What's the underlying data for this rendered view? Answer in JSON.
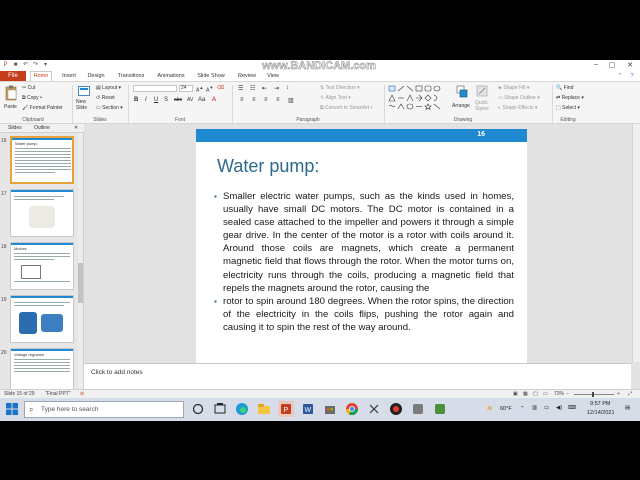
{
  "titlebar": {
    "watermark": "www.BANDICAM.com",
    "minimize": "–",
    "maximize": "▢",
    "close": "✕"
  },
  "tabs": [
    "File",
    "Home",
    "Insert",
    "Design",
    "Transitions",
    "Animations",
    "Slide Show",
    "Review",
    "View"
  ],
  "ribbon": {
    "clipboard": {
      "paste": "Paste",
      "cut": "Cut",
      "copy": "Copy",
      "format_painter": "Format Painter",
      "label": "Clipboard"
    },
    "slides": {
      "new_slide": "New Slide",
      "layout": "Layout",
      "reset": "Reset",
      "section": "Section",
      "label": "Slides"
    },
    "font": {
      "label": "Font",
      "size": "24"
    },
    "paragraph": {
      "text_direction": "Text Direction",
      "align_text": "Align Text",
      "smartart": "Convert to SmartArt",
      "label": "Paragraph"
    },
    "drawing": {
      "arrange": "Arrange",
      "quick_styles": "Quick Styles",
      "shape_fill": "Shape Fill",
      "shape_outline": "Shape Outline",
      "shape_effects": "Shape Effects",
      "label": "Drawing"
    },
    "editing": {
      "find": "Find",
      "replace": "Replace",
      "select": "Select",
      "label": "Editing"
    }
  },
  "left_panel": {
    "tabs": [
      "Slides",
      "Outline"
    ],
    "thumbnails": [
      {
        "num": "16",
        "title": "Water pump:"
      },
      {
        "num": "17",
        "title": ""
      },
      {
        "num": "18",
        "title": "Motors:"
      },
      {
        "num": "19",
        "title": ""
      },
      {
        "num": "20",
        "title": "Voltage regulator"
      }
    ]
  },
  "slide": {
    "number": "16",
    "title": "Water pump:",
    "bullets": [
      "Smaller electric water pumps, such as the kinds used in homes, usually have small DC motors. The DC motor is contained in a sealed case attached to the impeller and powers it through a simple gear drive. In the center of the motor is a rotor with coils around it. Around those coils are magnets, which create a permanent magnetic field that flows through the rotor. When the motor turns on, electricity runs through the coils, producing a magnetic field that repels the magnets around the rotor, causing the",
      "rotor to spin around 180 degrees. When the rotor spins, the direction of the electricity in the coils flips, pushing the rotor again and causing it to spin the rest of the way around."
    ]
  },
  "notes": {
    "placeholder": "Click to add notes"
  },
  "status": {
    "slide_of": "Slide 15 of 29",
    "theme": "\"Final PPT\"",
    "zoom": "73%"
  },
  "taskbar": {
    "search_placeholder": "Type here to search",
    "weather": "60°F",
    "time": "9:57 PM",
    "date": "12/14/2021"
  },
  "colors": {
    "accent": "#1f8ad1",
    "title": "#2d6a8e",
    "file_tab": "#c43e1c"
  }
}
